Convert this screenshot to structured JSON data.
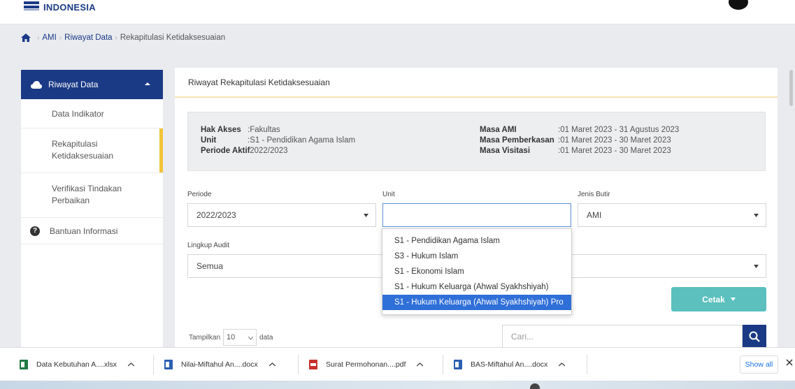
{
  "header": {
    "brand": "INDONESIA"
  },
  "breadcrumb": {
    "items": [
      "AMI",
      "Riwayat Data",
      "Rekapitulasi Ketidaksesuaian"
    ]
  },
  "sidebar": {
    "section": "Riwayat Data",
    "items": [
      {
        "label": "Data Indikator"
      },
      {
        "label": "Rekapitulasi Ketidaksesuaian"
      },
      {
        "label": "Verifikasi Tindakan Perbaikan"
      }
    ],
    "help": "Bantuan Informasi"
  },
  "panel": {
    "title": "Riwayat Rekapitulasi Ketidaksesuaian",
    "info_left": [
      {
        "key": "Hak Akses",
        "value": ":Fakultas"
      },
      {
        "key": "Unit",
        "value": ":S1 - Pendidikan Agama Islam"
      },
      {
        "key": "Periode Aktif",
        "value": ":2022/2023"
      }
    ],
    "info_right": [
      {
        "key": "Masa AMI",
        "value": ":01 Maret 2023 - 31 Agustus 2023"
      },
      {
        "key": "Masa Pemberkasan",
        "value": ":01 Maret 2023 - 30 Maret 2023"
      },
      {
        "key": "Masa Visitasi",
        "value": ":01 Maret 2023 - 30 Maret 2023"
      }
    ]
  },
  "filters": {
    "periode": {
      "label": "Periode",
      "value": "2022/2023"
    },
    "unit": {
      "label": "Unit",
      "value": ""
    },
    "jenis_butir": {
      "label": "Jenis Butir",
      "value": "AMI"
    },
    "lingkup_audit": {
      "label": "Lingkup Audit",
      "value": "Semua"
    }
  },
  "unit_dropdown": {
    "options": [
      "S1 - Pendidikan Agama Islam",
      "S3 - Hukum Islam",
      "S1 - Ekonomi Islam",
      "S1 - Hukum Keluarga (Ahwal Syakhshiyah)",
      "S1 - Hukum Keluarga (Ahwal Syakhshiyah) Pro"
    ],
    "selected_index": 4
  },
  "actions": {
    "cetak": "Cetak"
  },
  "table_controls": {
    "show_prefix": "Tampilkan",
    "page_size": "10",
    "show_suffix": "data",
    "search_placeholder": "Cari..."
  },
  "downloads": {
    "items": [
      {
        "name": "Data Kebutuhan A....xlsx",
        "icon": "excel-file-icon"
      },
      {
        "name": "Nilai-Miftahul An....docx",
        "icon": "word-file-icon"
      },
      {
        "name": "Surat Permohonan....pdf",
        "icon": "pdf-file-icon"
      },
      {
        "name": "BAS-Miftahul An....docx",
        "icon": "word-file-icon"
      }
    ],
    "show_all": "Show all"
  },
  "colors": {
    "primary": "#1b3a86",
    "accent": "#f2c43a",
    "button": "#5bc0be",
    "selection": "#2f6fd8"
  }
}
